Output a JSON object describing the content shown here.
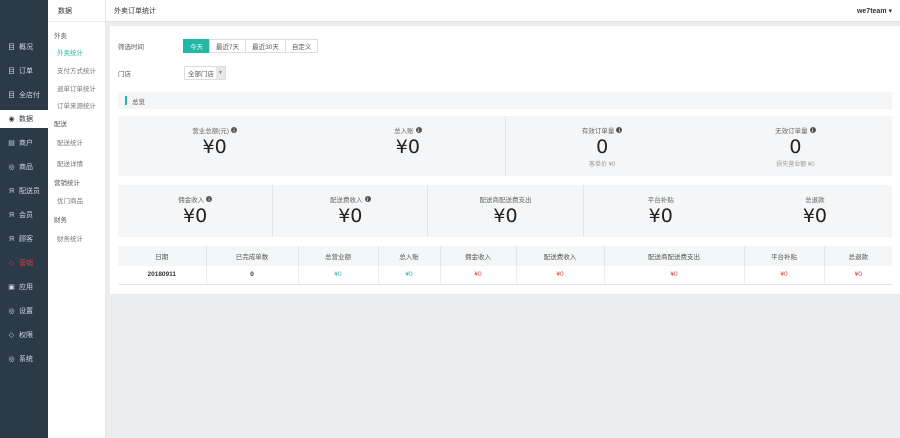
{
  "sidebar": {
    "items": [
      {
        "icon": "目",
        "label": "概况"
      },
      {
        "icon": "目",
        "label": "订单"
      },
      {
        "icon": "目",
        "label": "全店付"
      },
      {
        "icon": "◉",
        "label": "数据"
      },
      {
        "icon": "▤",
        "label": "商户"
      },
      {
        "icon": "◎",
        "label": "商品"
      },
      {
        "icon": "Я",
        "label": "配送员"
      },
      {
        "icon": "Я",
        "label": "会员"
      },
      {
        "icon": "Я",
        "label": "顾客"
      },
      {
        "icon": "◇",
        "label": "营销"
      },
      {
        "icon": "▣",
        "label": "应用"
      },
      {
        "icon": "◎",
        "label": "设置"
      },
      {
        "icon": "◇",
        "label": "权限"
      },
      {
        "icon": "◎",
        "label": "系统"
      }
    ]
  },
  "subnav": {
    "header": "数据",
    "groups": [
      {
        "label": "外卖",
        "items": [
          "外卖统计",
          "支付方式统计",
          "退单订单统计",
          "订单来源统计"
        ]
      },
      {
        "label": "配送",
        "items": [
          "配送统计",
          "配送详情"
        ]
      },
      {
        "label": "营销统计",
        "items": [
          "优门商品"
        ]
      },
      {
        "label": "财务",
        "items": [
          "财务统计"
        ]
      }
    ]
  },
  "topbar": {
    "title": "外卖订单统计",
    "user": "we7team ▾"
  },
  "filters": {
    "time_label": "筛选时间",
    "time_options": [
      "今天",
      "最近7天",
      "最近30天",
      "自定义"
    ],
    "store_label": "门店",
    "store_value": "全部门店",
    "store_caret": "▼"
  },
  "section": {
    "title": "总览"
  },
  "stats_row1": [
    {
      "label": "营业总额(元)",
      "value": "¥0",
      "sub": ""
    },
    {
      "label": "总入账",
      "value": "¥0",
      "sub": ""
    },
    {
      "label": "有效订单量",
      "value": "0",
      "sub": "客单价 ¥0"
    },
    {
      "label": "无效订单量",
      "value": "0",
      "sub": "损失营业额 ¥0"
    }
  ],
  "stats_row2": [
    {
      "label": "佣金收入",
      "value": "¥0"
    },
    {
      "label": "配送费收入",
      "value": "¥0"
    },
    {
      "label": "配送商配送费支出",
      "value": "¥0"
    },
    {
      "label": "平台补贴",
      "value": "¥0"
    },
    {
      "label": "总退款",
      "value": "¥0"
    }
  ],
  "table": {
    "headers": [
      "日期",
      "已完成单数",
      "总营业额",
      "总入账",
      "佣金收入",
      "配送费收入",
      "配送商配送费支出",
      "平台补贴",
      "总退款"
    ],
    "rows": [
      [
        "20180911",
        "0",
        "¥0",
        "¥0",
        "¥0",
        "¥0",
        "¥0",
        "¥0",
        "¥0"
      ]
    ]
  },
  "colors": {
    "accent": "#23b7a6",
    "negative": "#e4393c",
    "sidebar": "#2c3a47"
  }
}
